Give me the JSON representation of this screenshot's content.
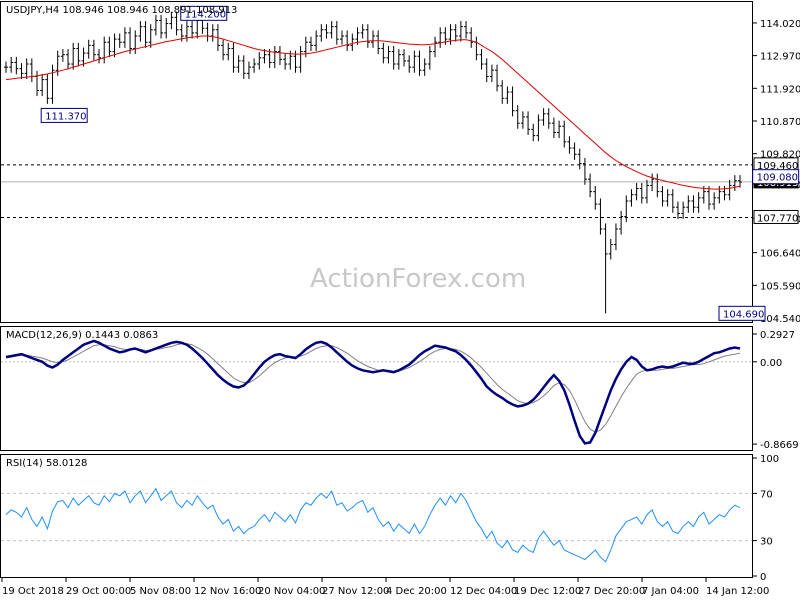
{
  "chart_data": [
    {
      "type": "line",
      "panel": "price",
      "symbol_line": "USDJPY,H4  108.946 108.946 108.891 108.913",
      "watermark": "ActionForex.com",
      "ylim": [
        104.54,
        114.5
      ],
      "y_ticks": [
        "114.020",
        "112.970",
        "111.920",
        "110.870",
        "109.820",
        "108.840",
        "107.740",
        "106.640",
        "105.590",
        "104.540"
      ],
      "horizontal_levels": [
        {
          "label": "109.460",
          "value": 109.46,
          "style": "dashed",
          "badge": "white"
        },
        {
          "label": "108.913",
          "value": 108.913,
          "style": "solid",
          "badge": "dark"
        },
        {
          "label": "107.770",
          "value": 107.77,
          "style": "dashed",
          "badge": "white"
        }
      ],
      "annotations": [
        {
          "label": "114.200",
          "x_bar": 40
        },
        {
          "label": "111.370",
          "x_bar": 7
        },
        {
          "label": "109.080",
          "x_bar": 146
        },
        {
          "label": "104.690",
          "x_bar": 148
        }
      ],
      "close_series": {
        "name": "USDJPY H4",
        "values": [
          112.6,
          112.75,
          112.55,
          112.4,
          112.7,
          112.3,
          111.85,
          112.2,
          111.6,
          112.5,
          112.95,
          113.0,
          112.7,
          113.2,
          112.8,
          113.05,
          113.3,
          113.0,
          112.9,
          113.4,
          113.1,
          113.5,
          113.4,
          113.7,
          113.2,
          113.6,
          113.9,
          113.4,
          113.8,
          114.1,
          113.7,
          114.0,
          114.2,
          113.8,
          113.6,
          113.9,
          113.7,
          114.1,
          113.85,
          113.6,
          113.8,
          113.3,
          113.0,
          113.2,
          112.6,
          112.8,
          112.4,
          112.6,
          112.7,
          112.9,
          113.0,
          112.75,
          113.1,
          112.85,
          112.7,
          112.95,
          112.6,
          113.1,
          113.4,
          113.3,
          113.6,
          113.8,
          113.7,
          113.9,
          113.5,
          113.6,
          113.3,
          113.5,
          113.7,
          113.8,
          113.4,
          113.6,
          113.2,
          112.9,
          113.1,
          112.7,
          113.0,
          112.8,
          112.6,
          112.95,
          112.5,
          112.7,
          113.1,
          113.4,
          113.7,
          113.5,
          113.8,
          113.6,
          113.9,
          113.7,
          113.4,
          113.0,
          112.7,
          112.3,
          112.5,
          112.0,
          111.6,
          111.8,
          111.2,
          110.8,
          111.0,
          110.6,
          110.4,
          110.9,
          111.1,
          110.8,
          110.5,
          110.7,
          110.2,
          110.0,
          109.8,
          109.5,
          109.0,
          108.6,
          108.2,
          107.4,
          106.6,
          106.9,
          107.4,
          107.8,
          108.3,
          108.5,
          108.7,
          108.4,
          108.8,
          109.0,
          108.6,
          108.3,
          108.5,
          108.1,
          107.9,
          108.1,
          108.3,
          108.1,
          108.4,
          108.6,
          108.2,
          108.4,
          108.6,
          108.5,
          108.8,
          108.95,
          108.91
        ],
        "ma_name": "moving average",
        "ma_values": [
          112.2,
          112.22,
          112.24,
          112.26,
          112.28,
          112.3,
          112.32,
          112.35,
          112.38,
          112.42,
          112.46,
          112.5,
          112.55,
          112.6,
          112.65,
          112.7,
          112.75,
          112.8,
          112.85,
          112.9,
          112.95,
          113.0,
          113.05,
          113.1,
          113.14,
          113.18,
          113.22,
          113.26,
          113.3,
          113.34,
          113.38,
          113.42,
          113.45,
          113.48,
          113.51,
          113.54,
          113.56,
          113.58,
          113.6,
          113.6,
          113.58,
          113.55,
          113.5,
          113.45,
          113.4,
          113.35,
          113.3,
          113.25,
          113.2,
          113.16,
          113.13,
          113.1,
          113.08,
          113.06,
          113.04,
          113.03,
          113.02,
          113.02,
          113.03,
          113.05,
          113.08,
          113.12,
          113.16,
          113.2,
          113.24,
          113.28,
          113.32,
          113.36,
          113.4,
          113.42,
          113.44,
          113.45,
          113.45,
          113.44,
          113.42,
          113.4,
          113.38,
          113.36,
          113.34,
          113.33,
          113.32,
          113.32,
          113.33,
          113.35,
          113.38,
          113.41,
          113.44,
          113.46,
          113.48,
          113.48,
          113.45,
          113.4,
          113.3,
          113.2,
          113.1,
          112.98,
          112.85,
          112.7,
          112.55,
          112.4,
          112.25,
          112.1,
          111.95,
          111.8,
          111.65,
          111.5,
          111.35,
          111.2,
          111.05,
          110.9,
          110.75,
          110.6,
          110.45,
          110.3,
          110.15,
          110.0,
          109.85,
          109.72,
          109.6,
          109.5,
          109.4,
          109.32,
          109.24,
          109.17,
          109.1,
          109.05,
          109.0,
          108.96,
          108.92,
          108.88,
          108.84,
          108.8,
          108.77,
          108.74,
          108.72,
          108.7,
          108.69,
          108.68,
          108.68,
          108.69,
          108.71,
          108.74,
          108.77
        ]
      }
    },
    {
      "type": "line",
      "panel": "macd",
      "label": "MACD(12,26,9) 0.1443 0.0863",
      "ylim": [
        -0.8869,
        0.2927
      ],
      "y_ticks": [
        "0.2927",
        "0.00",
        "-0.8669"
      ],
      "main_series": {
        "name": "MACD",
        "values": [
          0.05,
          0.06,
          0.07,
          0.08,
          0.06,
          0.04,
          0.02,
          0.0,
          -0.04,
          -0.06,
          -0.03,
          0.02,
          0.06,
          0.1,
          0.14,
          0.18,
          0.2,
          0.22,
          0.2,
          0.17,
          0.14,
          0.12,
          0.1,
          0.11,
          0.13,
          0.14,
          0.12,
          0.1,
          0.12,
          0.14,
          0.16,
          0.18,
          0.2,
          0.21,
          0.2,
          0.18,
          0.14,
          0.09,
          0.04,
          -0.02,
          -0.08,
          -0.14,
          -0.19,
          -0.23,
          -0.26,
          -0.27,
          -0.25,
          -0.2,
          -0.13,
          -0.06,
          0.0,
          0.04,
          0.07,
          0.08,
          0.06,
          0.05,
          0.04,
          0.08,
          0.13,
          0.17,
          0.2,
          0.21,
          0.19,
          0.15,
          0.1,
          0.05,
          0.0,
          -0.04,
          -0.07,
          -0.09,
          -0.1,
          -0.11,
          -0.1,
          -0.09,
          -0.1,
          -0.11,
          -0.09,
          -0.06,
          -0.03,
          0.02,
          0.07,
          0.11,
          0.14,
          0.17,
          0.16,
          0.15,
          0.13,
          0.11,
          0.07,
          0.02,
          -0.04,
          -0.11,
          -0.18,
          -0.26,
          -0.31,
          -0.35,
          -0.38,
          -0.42,
          -0.45,
          -0.47,
          -0.46,
          -0.44,
          -0.4,
          -0.34,
          -0.27,
          -0.2,
          -0.14,
          -0.2,
          -0.3,
          -0.45,
          -0.62,
          -0.78,
          -0.86,
          -0.85,
          -0.75,
          -0.6,
          -0.45,
          -0.3,
          -0.18,
          -0.08,
          0.0,
          0.05,
          0.02,
          -0.05,
          -0.09,
          -0.08,
          -0.06,
          -0.05,
          -0.06,
          -0.05,
          -0.03,
          -0.01,
          -0.02,
          -0.02,
          0.0,
          0.03,
          0.06,
          0.09,
          0.1,
          0.12,
          0.14,
          0.15,
          0.14
        ]
      },
      "signal_series": {
        "name": "Signal",
        "values": [
          0.04,
          0.05,
          0.06,
          0.07,
          0.07,
          0.06,
          0.05,
          0.04,
          0.02,
          0.0,
          -0.01,
          0.0,
          0.02,
          0.05,
          0.08,
          0.11,
          0.14,
          0.17,
          0.18,
          0.18,
          0.17,
          0.16,
          0.14,
          0.13,
          0.13,
          0.13,
          0.13,
          0.12,
          0.12,
          0.13,
          0.14,
          0.15,
          0.16,
          0.18,
          0.19,
          0.19,
          0.18,
          0.15,
          0.12,
          0.08,
          0.03,
          -0.02,
          -0.07,
          -0.12,
          -0.17,
          -0.2,
          -0.22,
          -0.22,
          -0.19,
          -0.15,
          -0.1,
          -0.05,
          -0.01,
          0.02,
          0.04,
          0.05,
          0.05,
          0.06,
          0.08,
          0.11,
          0.14,
          0.16,
          0.17,
          0.17,
          0.15,
          0.12,
          0.09,
          0.05,
          0.01,
          -0.02,
          -0.05,
          -0.07,
          -0.09,
          -0.09,
          -0.09,
          -0.1,
          -0.1,
          -0.08,
          -0.06,
          -0.03,
          0.0,
          0.04,
          0.08,
          0.11,
          0.13,
          0.14,
          0.14,
          0.13,
          0.11,
          0.08,
          0.04,
          -0.01,
          -0.06,
          -0.12,
          -0.18,
          -0.24,
          -0.29,
          -0.33,
          -0.37,
          -0.41,
          -0.43,
          -0.44,
          -0.43,
          -0.4,
          -0.36,
          -0.31,
          -0.25,
          -0.22,
          -0.24,
          -0.3,
          -0.4,
          -0.52,
          -0.63,
          -0.71,
          -0.74,
          -0.72,
          -0.66,
          -0.57,
          -0.47,
          -0.37,
          -0.28,
          -0.2,
          -0.13,
          -0.1,
          -0.09,
          -0.09,
          -0.09,
          -0.08,
          -0.07,
          -0.07,
          -0.06,
          -0.05,
          -0.04,
          -0.03,
          -0.03,
          -0.02,
          0.0,
          0.02,
          0.04,
          0.06,
          0.07,
          0.08,
          0.09
        ]
      }
    },
    {
      "type": "line",
      "panel": "rsi",
      "label": "RSI(14) 58.0128",
      "ylim": [
        0,
        100
      ],
      "y_ticks": [
        "100",
        "70",
        "30",
        "0"
      ],
      "levels": [
        70,
        30
      ],
      "series": {
        "name": "RSI",
        "values": [
          52,
          56,
          54,
          50,
          58,
          48,
          42,
          50,
          40,
          55,
          63,
          64,
          58,
          66,
          60,
          64,
          68,
          62,
          60,
          68,
          63,
          70,
          68,
          72,
          62,
          68,
          72,
          62,
          68,
          74,
          64,
          68,
          72,
          62,
          58,
          64,
          60,
          68,
          62,
          57,
          60,
          50,
          44,
          48,
          38,
          42,
          36,
          40,
          42,
          48,
          52,
          46,
          54,
          50,
          46,
          52,
          45,
          56,
          62,
          60,
          66,
          70,
          66,
          72,
          60,
          62,
          55,
          58,
          62,
          64,
          54,
          58,
          48,
          42,
          46,
          38,
          44,
          40,
          36,
          44,
          36,
          42,
          52,
          60,
          66,
          60,
          68,
          62,
          70,
          64,
          55,
          46,
          40,
          32,
          38,
          28,
          24,
          30,
          22,
          20,
          26,
          22,
          20,
          32,
          38,
          32,
          26,
          30,
          22,
          20,
          18,
          16,
          14,
          18,
          22,
          16,
          12,
          22,
          34,
          40,
          46,
          48,
          50,
          44,
          52,
          56,
          46,
          42,
          46,
          38,
          36,
          42,
          46,
          42,
          50,
          54,
          44,
          48,
          52,
          50,
          56,
          60,
          58
        ]
      },
      "x_tick_labels": [
        "19 Oct 2018",
        "29 Oct 00:00",
        "5 Nov 08:00",
        "12 Nov 16:00",
        "20 Nov 04:00",
        "27 Nov 12:00",
        "4 Dec 20:00",
        "12 Dec 04:00",
        "19 Dec 12:00",
        "27 Dec 20:00",
        "7 Jan 04:00",
        "14 Jan 12:00"
      ]
    }
  ]
}
